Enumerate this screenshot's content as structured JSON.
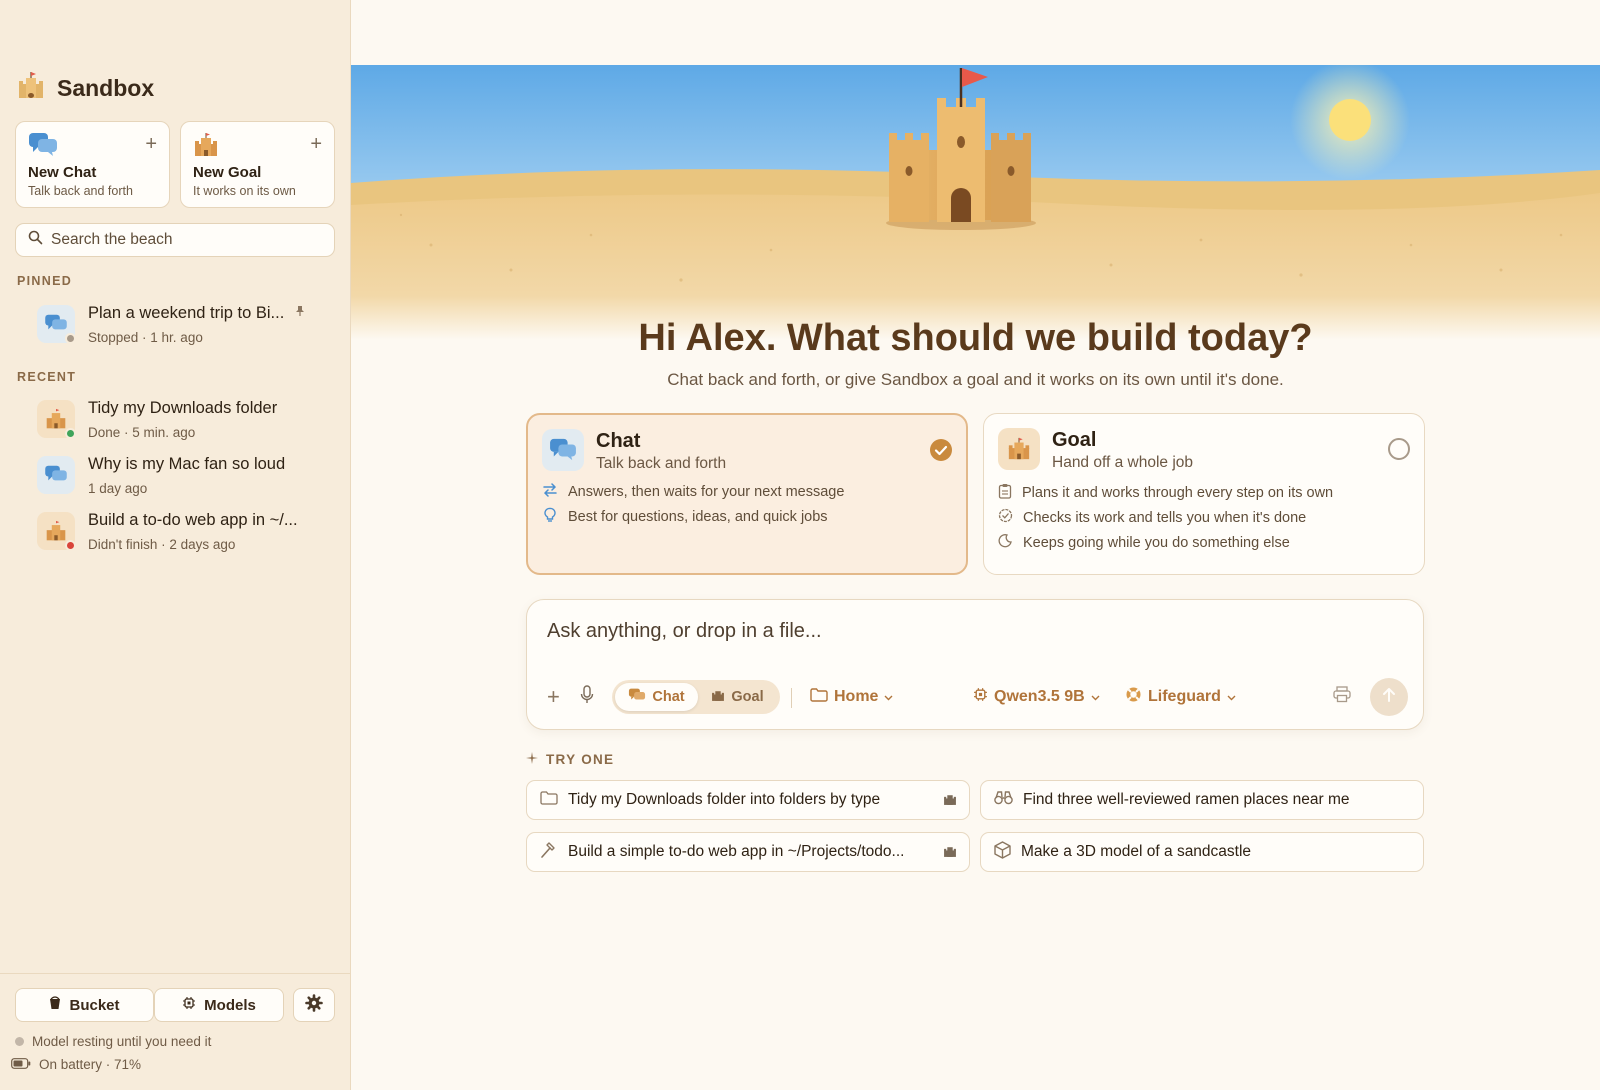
{
  "app": {
    "name": "Sandbox"
  },
  "sidebar": {
    "new_chat": {
      "title": "New Chat",
      "subtitle": "Talk back and forth"
    },
    "new_goal": {
      "title": "New Goal",
      "subtitle": "It works on its own"
    },
    "search": {
      "placeholder": "Search the beach",
      "value": ""
    },
    "pinned_label": "PINNED",
    "pinned": [
      {
        "title": "Plan a weekend trip to Bi...",
        "meta": "Stopped · 1 hr. ago",
        "kind": "chat",
        "status_color": "#a89a8a",
        "pinned": true
      }
    ],
    "recent_label": "RECENT",
    "recent": [
      {
        "title": "Tidy my Downloads folder",
        "meta": "Done · 5 min. ago",
        "kind": "goal",
        "status_color": "#3fa45b"
      },
      {
        "title": "Why is my Mac fan so loud",
        "meta": "1 day ago",
        "kind": "chat"
      },
      {
        "title": "Build a to-do web app in ~/...",
        "meta": "Didn't finish · 2 days ago",
        "kind": "goal",
        "status_color": "#d9443a"
      }
    ],
    "footer": {
      "bucket_label": "Bucket",
      "models_label": "Models",
      "model_status": "Model resting until you need it",
      "battery_status": "On battery · 71%"
    }
  },
  "main": {
    "greeting": "Hi Alex. What should we build today?",
    "subtitle": "Chat back and forth, or give Sandbox a goal and it works on its own until it's done.",
    "modes": [
      {
        "title": "Chat",
        "subtitle": "Talk back and forth",
        "selected": true,
        "features": [
          "Answers, then waits for your next message",
          "Best for questions, ideas, and quick jobs"
        ]
      },
      {
        "title": "Goal",
        "subtitle": "Hand off a whole job",
        "selected": false,
        "features": [
          "Plans it and works through every step on its own",
          "Checks its work and tells you when it's done",
          "Keeps going while you do something else"
        ]
      }
    ],
    "composer": {
      "placeholder": "Ask anything, or drop in a file...",
      "value": "",
      "seg_chat": "Chat",
      "seg_goal": "Goal",
      "folder": "Home",
      "model": "Qwen3.5 9B",
      "safety": "Lifeguard"
    },
    "try_label": "TRY ONE",
    "suggestions": [
      {
        "text": "Tidy my Downloads folder into folders by type",
        "icon": "folder-icon",
        "goal": true
      },
      {
        "text": "Find three well-reviewed ramen places near me",
        "icon": "binoculars-icon",
        "goal": false
      },
      {
        "text": "Build a simple to-do web app in ~/Projects/todo...",
        "icon": "hammer-icon",
        "goal": true
      },
      {
        "text": "Make a 3D model of a sandcastle",
        "icon": "cube-icon",
        "goal": false
      }
    ]
  },
  "colors": {
    "accent": "#c98a3e",
    "sidebar_bg": "#f7ecdb",
    "page_bg": "#fdf9f2",
    "chat_blue": "#4a8fd0"
  }
}
